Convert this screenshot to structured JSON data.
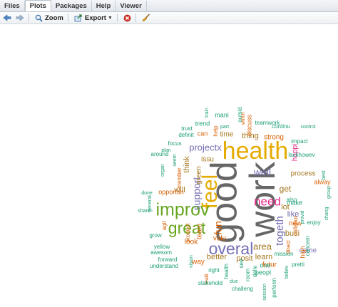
{
  "tabs": [
    {
      "label": "Files"
    },
    {
      "label": "Plots"
    },
    {
      "label": "Packages"
    },
    {
      "label": "Help"
    },
    {
      "label": "Viewer"
    }
  ],
  "toolbar": {
    "zoom_label": "Zoom",
    "export_label": "Export"
  },
  "colors": {
    "teal": "#1b9e77",
    "orange": "#d95f02",
    "purple": "#7570b3",
    "magenta": "#e7298a",
    "green": "#66a61e",
    "gold": "#e6ab02",
    "brown": "#a6761d",
    "gray": "#666666"
  },
  "wordcloud": {
    "words": [
      {
        "text": "good",
        "color": "gray"
      },
      {
        "text": "work",
        "color": "gray"
      },
      {
        "text": "health",
        "color": "gold"
      },
      {
        "text": "feel",
        "color": "gold"
      },
      {
        "text": "improv",
        "color": "green"
      },
      {
        "text": "great",
        "color": "green"
      },
      {
        "text": "overal",
        "color": "purple"
      },
      {
        "text": "need",
        "color": "magenta"
      },
      {
        "text": "togeth",
        "color": "purple"
      },
      {
        "text": "support",
        "color": "purple"
      },
      {
        "text": "projectx",
        "color": "purple"
      },
      {
        "text": "well",
        "color": "purple"
      },
      {
        "text": "fun",
        "color": "orange"
      },
      {
        "text": "area",
        "color": "brown"
      },
      {
        "text": "process",
        "color": "brown"
      },
      {
        "text": "get",
        "color": "brown"
      },
      {
        "text": "like",
        "color": "purple"
      },
      {
        "text": "better",
        "color": "brown"
      },
      {
        "text": "posit",
        "color": "brown"
      },
      {
        "text": "learn",
        "color": "brown"
      },
      {
        "text": "come",
        "color": "purple"
      },
      {
        "text": "busi",
        "color": "brown"
      },
      {
        "text": "lot",
        "color": "brown"
      },
      {
        "text": "will",
        "color": "brown"
      },
      {
        "text": "think",
        "color": "brown"
      },
      {
        "text": "time",
        "color": "brown"
      },
      {
        "text": "thing",
        "color": "brown"
      },
      {
        "text": "issu",
        "color": "brown"
      },
      {
        "text": "strong",
        "color": "orange"
      },
      {
        "text": "green",
        "color": "brown"
      },
      {
        "text": "team",
        "color": "orange"
      },
      {
        "text": "valu",
        "color": "orange"
      },
      {
        "text": "look",
        "color": "orange"
      },
      {
        "text": "new",
        "color": "orange"
      },
      {
        "text": "alway",
        "color": "orange"
      },
      {
        "text": "make",
        "color": "teal"
      },
      {
        "text": "high",
        "color": "orange"
      },
      {
        "text": "futur",
        "color": "orange"
      },
      {
        "text": "way",
        "color": "orange"
      },
      {
        "text": "can",
        "color": "orange"
      },
      {
        "text": "happi",
        "color": "magenta"
      },
      {
        "text": "mani",
        "color": "teal"
      },
      {
        "text": "outsid",
        "color": "teal"
      },
      {
        "text": "discuss",
        "color": "orange"
      },
      {
        "text": "teamwork",
        "color": "teal"
      },
      {
        "text": "continu",
        "color": "teal"
      },
      {
        "text": "trend",
        "color": "teal"
      },
      {
        "text": "help",
        "color": "orange"
      },
      {
        "text": "part",
        "color": "teal"
      },
      {
        "text": "within",
        "color": "orange"
      },
      {
        "text": "train",
        "color": "teal"
      },
      {
        "text": "trust",
        "color": "teal"
      },
      {
        "text": "definit",
        "color": "teal"
      },
      {
        "text": "focus",
        "color": "teal"
      },
      {
        "text": "plan",
        "color": "teal"
      },
      {
        "text": "around",
        "color": "teal"
      },
      {
        "text": "seem",
        "color": "teal"
      },
      {
        "text": "organ",
        "color": "teal"
      },
      {
        "text": "done",
        "color": "teal"
      },
      {
        "text": "share",
        "color": "teal"
      },
      {
        "text": "general",
        "color": "teal"
      },
      {
        "text": "agil",
        "color": "orange"
      },
      {
        "text": "opportun",
        "color": "orange"
      },
      {
        "text": "member",
        "color": "orange"
      },
      {
        "text": "product",
        "color": "orange"
      },
      {
        "text": "grow",
        "color": "teal"
      },
      {
        "text": "yellow",
        "color": "teal"
      },
      {
        "text": "awesom",
        "color": "teal"
      },
      {
        "text": "forward",
        "color": "teal"
      },
      {
        "text": "understand",
        "color": "teal"
      },
      {
        "text": "vision",
        "color": "teal"
      },
      {
        "text": "realli",
        "color": "orange"
      },
      {
        "text": "right",
        "color": "teal"
      },
      {
        "text": "stakehold",
        "color": "teal"
      },
      {
        "text": "health",
        "color": "teal"
      },
      {
        "text": "due",
        "color": "teal"
      },
      {
        "text": "room",
        "color": "teal"
      },
      {
        "text": "see",
        "color": "teal"
      },
      {
        "text": "challeng",
        "color": "teal"
      },
      {
        "text": "deliv",
        "color": "teal"
      },
      {
        "text": "one",
        "color": "teal"
      },
      {
        "text": "peopl",
        "color": "teal"
      },
      {
        "text": "session",
        "color": "teal"
      },
      {
        "text": "perform",
        "color": "teal"
      },
      {
        "text": "believ",
        "color": "teal"
      },
      {
        "text": "pretti",
        "color": "teal"
      },
      {
        "text": "mission",
        "color": "teal"
      },
      {
        "text": "direct",
        "color": "orange"
      },
      {
        "text": "concern",
        "color": "teal"
      },
      {
        "text": "collabor",
        "color": "orange"
      },
      {
        "text": "provid",
        "color": "teal"
      },
      {
        "text": "enjoy",
        "color": "teal"
      },
      {
        "text": "group",
        "color": "teal"
      },
      {
        "text": "chang",
        "color": "teal"
      },
      {
        "text": "best",
        "color": "teal"
      },
      {
        "text": "also",
        "color": "teal"
      },
      {
        "text": "lackhowev",
        "color": "teal"
      },
      {
        "text": "impact",
        "color": "teal"
      },
      {
        "text": "control",
        "color": "teal"
      }
    ]
  }
}
